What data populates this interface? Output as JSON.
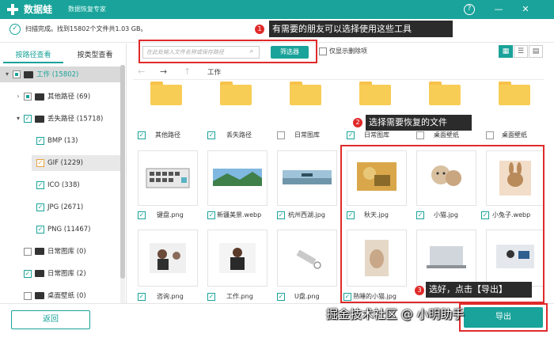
{
  "app": {
    "name": "数据蛙",
    "subtitle": "数据恢复专家",
    "accent": "#1aa39a",
    "window_buttons": [
      "help-icon",
      "minimize-icon",
      "close-icon"
    ]
  },
  "status": {
    "text": "扫描完成。找到15802个文件共1.03 GB。"
  },
  "toolbar": {
    "search_placeholder": "在此处输入文件名称或保存路径",
    "filter_label": "筛选器",
    "only_deleted_label": "仅显示删除项",
    "views": [
      "grid-view-icon",
      "list-view-icon",
      "detail-view-icon"
    ]
  },
  "sidebar": {
    "tabs": [
      "按路径查看",
      "按类型查看"
    ],
    "tree": {
      "root": "工作 (15802)",
      "other": "其他路径 (69)",
      "lost": "丢失路径 (15718)",
      "bmp": "BMP (13)",
      "gif": "GIF (1229)",
      "ico": "ICO (338)",
      "jpg": "JPG (2671)",
      "png": "PNG (11467)",
      "daily1": "日常图库 (0)",
      "daily2": "日常图库 (2)",
      "desktop": "桌面壁纸 (0)"
    },
    "back_label": "返回"
  },
  "breadcrumb": {
    "current": "工作"
  },
  "grid": {
    "folders": [
      "其他路径",
      "丢失路径",
      "日常图库",
      "日常图库",
      "桌面壁纸",
      "桌面壁纸"
    ],
    "row2": [
      "键盘.png",
      "新疆美景.webp",
      "杭州西湖.jpg",
      "秋天.jpg",
      "小猫.jpg",
      "小兔子.webp"
    ],
    "row3": [
      "咨询.png",
      "工作.png",
      "U盘.png",
      "熟睡的小猫.jpg",
      "",
      ""
    ]
  },
  "callouts": {
    "one": "有需要的朋友可以选择使用这些工具",
    "two": "选择需要恢复的文件",
    "three": "选好，点击【导出】",
    "n1": "1",
    "n2": "2",
    "n3": "3"
  },
  "export_label": "导出",
  "watermark": "掘金技术社区 @ 小明助手"
}
